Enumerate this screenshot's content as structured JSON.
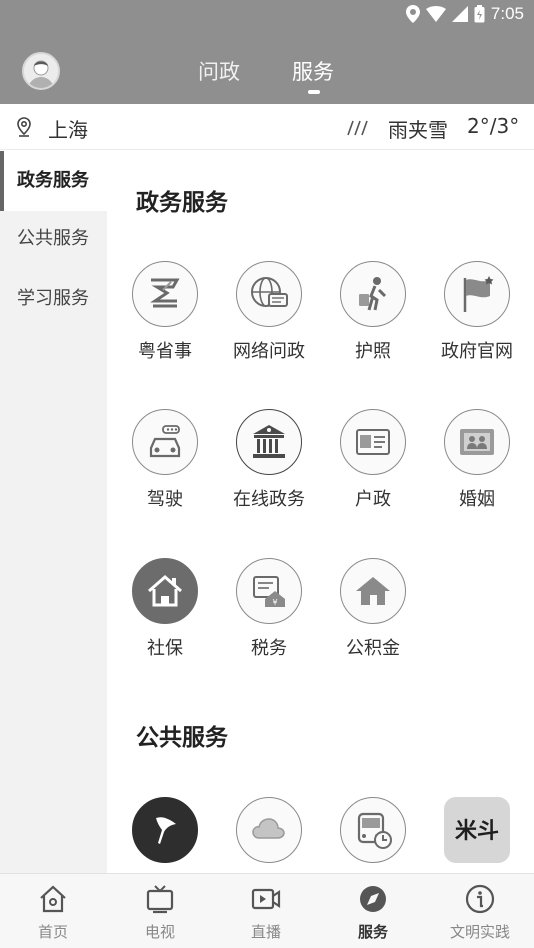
{
  "status_bar": {
    "time": "7:05"
  },
  "top_tabs": [
    {
      "label": "问政",
      "active": false
    },
    {
      "label": "服务",
      "active": true
    }
  ],
  "location": {
    "city": "上海",
    "weather": "雨夹雪",
    "temperature": "2°/3°"
  },
  "sidebar": {
    "items": [
      {
        "label": "政务服务",
        "active": true
      },
      {
        "label": "公共服务",
        "active": false
      },
      {
        "label": "学习服务",
        "active": false
      }
    ]
  },
  "sections": [
    {
      "title": "政务服务",
      "items": [
        {
          "label": "粤省事",
          "icon": "yue-sheng-shi-icon"
        },
        {
          "label": "网络问政",
          "icon": "globe-chat-icon"
        },
        {
          "label": "护照",
          "icon": "traveler-icon"
        },
        {
          "label": "政府官网",
          "icon": "flag-icon"
        },
        {
          "label": "驾驶",
          "icon": "car-icon"
        },
        {
          "label": "在线政务",
          "icon": "government-building-icon"
        },
        {
          "label": "户政",
          "icon": "id-card-icon"
        },
        {
          "label": "婚姻",
          "icon": "couple-icon"
        },
        {
          "label": "社保",
          "icon": "home-icon"
        },
        {
          "label": "税务",
          "icon": "tax-icon"
        },
        {
          "label": "公积金",
          "icon": "house-fund-icon"
        }
      ]
    },
    {
      "title": "公共服务",
      "items": [
        {
          "label": "",
          "icon": "flag-app-icon"
        },
        {
          "label": "",
          "icon": "cloud-icon"
        },
        {
          "label": "",
          "icon": "bus-clock-icon"
        },
        {
          "label": "",
          "icon": "brand-logo-icon",
          "logo_text": "米斗"
        }
      ]
    }
  ],
  "bottom_nav": [
    {
      "label": "首页",
      "icon": "home-outline-icon",
      "active": false
    },
    {
      "label": "电视",
      "icon": "tv-icon",
      "active": false
    },
    {
      "label": "直播",
      "icon": "live-video-icon",
      "active": false
    },
    {
      "label": "服务",
      "icon": "compass-icon",
      "active": true
    },
    {
      "label": "文明实践",
      "icon": "info-icon",
      "active": false
    }
  ]
}
